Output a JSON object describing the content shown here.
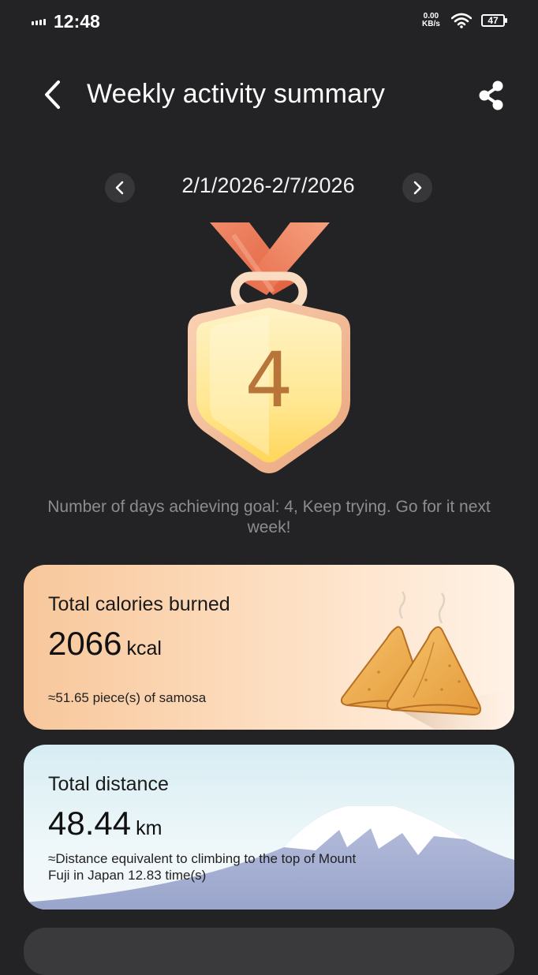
{
  "status": {
    "time": "12:48",
    "speed_value": "0.00",
    "speed_unit": "KB/s",
    "battery": "47"
  },
  "header": {
    "title": "Weekly activity summary"
  },
  "date_nav": {
    "range": "2/1/2026-2/7/2026"
  },
  "medal": {
    "days": "4"
  },
  "goal_message": "Number of days achieving goal: 4, Keep trying. Go for it next week!",
  "calories": {
    "title": "Total calories burned",
    "value": "2066",
    "unit": "kcal",
    "note": "≈51.65 piece(s) of samosa"
  },
  "distance": {
    "title": "Total distance",
    "value": "48.44",
    "unit": "km",
    "note": "≈Distance equivalent to climbing to the top of Mount Fuji in Japan 12.83 time(s)"
  },
  "colors": {
    "background": "#232325",
    "medal_number": "#b8753a",
    "calorie_card": "#f8c79b",
    "distance_card": "#d7edf3"
  },
  "icons": [
    "signal-icon",
    "wifi-icon",
    "battery-icon",
    "back-arrow-icon",
    "share-icon",
    "chevron-left-icon",
    "chevron-right-icon",
    "medal-icon",
    "samosa-icon",
    "mount-fuji-icon"
  ]
}
